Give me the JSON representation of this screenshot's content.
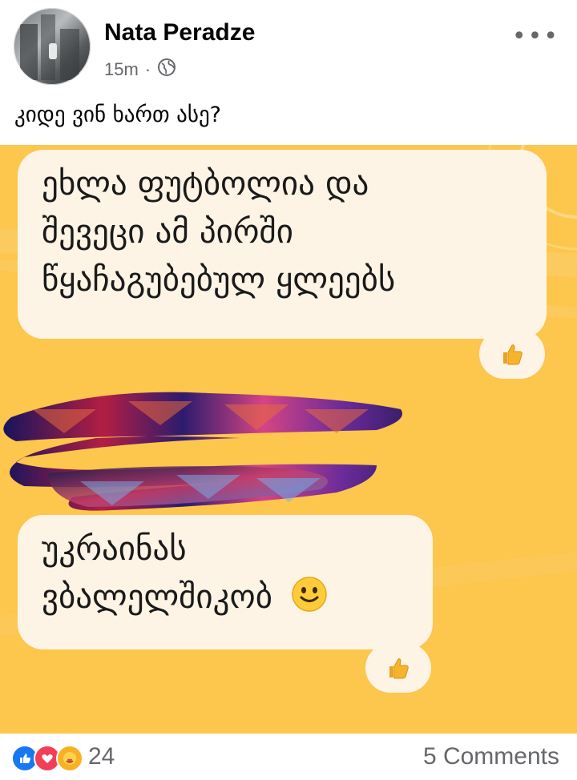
{
  "post": {
    "author": "Nata Peradze",
    "time": "15m",
    "separator": "·",
    "privacy_icon": "globe-icon",
    "more_icon": "more-options-icon",
    "more_label": "•••",
    "caption": "კიდე ვინ ხართ ასე?"
  },
  "photo": {
    "background_color": "#fdc64c",
    "bubble_color": "#fdf4e6",
    "message1": {
      "lines": [
        "ეხლა ფუტბოლია და",
        "შევეცი ამ პირში",
        "წყაჩაგუბებულ ყლეებს"
      ],
      "reaction_icon": "thumbs-up-icon"
    },
    "redacted_icon": "scribble-redaction",
    "message2": {
      "lines": [
        "უკრაინას",
        "ვბალელშიკობ"
      ],
      "emoji_icon": "smiley-icon",
      "reaction_icon": "thumbs-up-icon"
    }
  },
  "footer": {
    "reactions": [
      "like-icon",
      "love-icon",
      "care-icon"
    ],
    "reaction_count": "24",
    "comments": "5 Comments"
  }
}
